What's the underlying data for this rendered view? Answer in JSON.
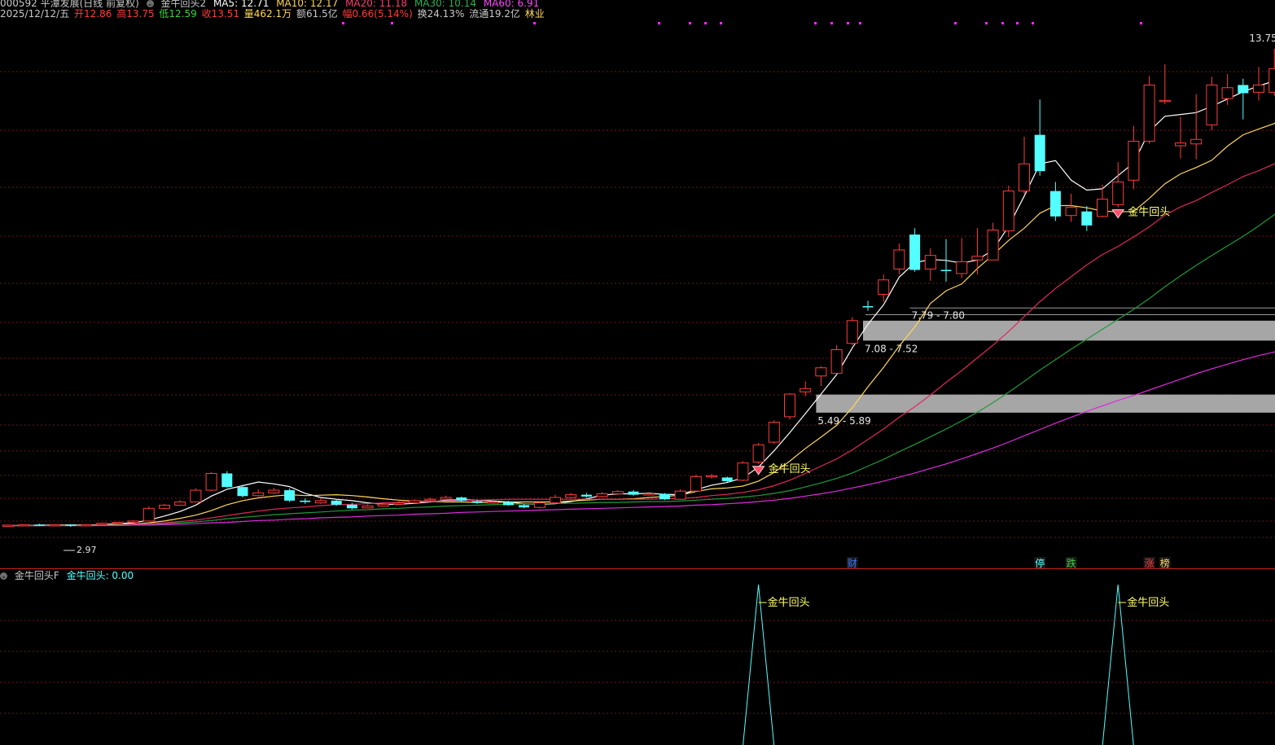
{
  "header": {
    "stock": "000592 平潭发展(日线 前复权)",
    "indicator": "金牛回头2",
    "ma5": "MA5: 12.71",
    "ma10": "MA10: 12.17",
    "ma20": "MA20: 11.18",
    "ma30": "MA30: 10.14",
    "ma60": "MA60: 6.91",
    "date": "2025/12/12/五",
    "open": "开12.86",
    "high": "高13.75",
    "low": "低12.59",
    "close": "收13.51",
    "volume": "量462.1万",
    "amount": "额61.5亿",
    "change": "幅0.66(5.14%)",
    "turnover": "换24.13%",
    "float_cap": "流通19.2亿",
    "sector": "林业"
  },
  "colors": {
    "up": "#ff3c3c",
    "down": "#54ffff",
    "ma5": "#ffffff",
    "ma10": "#ffd75a",
    "ma20": "#e0285a",
    "ma30": "#1f9a3a",
    "ma60": "#e02ae0",
    "grid": "#6e1616"
  },
  "main_chart": {
    "price_range": [
      2.2,
      14.2
    ],
    "max_label": "13.75",
    "min_label": "2.97",
    "zones": [
      {
        "label": "7.79 - 7.80",
        "low": 7.79,
        "high": 7.8,
        "start": 58
      },
      {
        "label": "7.08 - 7.52",
        "low": 7.08,
        "high": 7.52,
        "start": 55
      },
      {
        "label": "5.49 - 5.89",
        "low": 5.49,
        "high": 5.89,
        "start": 52
      }
    ],
    "signals": [
      {
        "index": 48,
        "label": "金牛回头"
      },
      {
        "index": 71,
        "label": "金牛回头"
      }
    ],
    "event_markers": [
      {
        "index": 54,
        "text": "财"
      },
      {
        "index": 66,
        "text": "停"
      },
      {
        "index": 68,
        "text": "跌"
      },
      {
        "index": 73,
        "text": "涨"
      },
      {
        "index": 74,
        "text": "榜"
      }
    ],
    "candles": [
      [
        3.0,
        3.01,
        2.98,
        3.02
      ],
      [
        3.01,
        3.02,
        3.0,
        3.03
      ],
      [
        3.02,
        3.01,
        2.99,
        3.04
      ],
      [
        3.01,
        3.02,
        3.0,
        3.03
      ],
      [
        3.02,
        3.0,
        2.97,
        3.03
      ],
      [
        3.0,
        3.02,
        2.99,
        3.03
      ],
      [
        3.02,
        3.05,
        3.01,
        3.06
      ],
      [
        3.05,
        3.07,
        3.04,
        3.08
      ],
      [
        3.07,
        3.1,
        3.06,
        3.12
      ],
      [
        3.1,
        3.38,
        3.09,
        3.42
      ],
      [
        3.38,
        3.45,
        3.36,
        3.48
      ],
      [
        3.45,
        3.52,
        3.44,
        3.56
      ],
      [
        3.52,
        3.78,
        3.51,
        3.82
      ],
      [
        3.78,
        4.15,
        3.76,
        4.18
      ],
      [
        4.15,
        3.85,
        3.83,
        4.2
      ],
      [
        3.85,
        3.65,
        3.62,
        3.9
      ],
      [
        3.66,
        3.72,
        3.64,
        3.8
      ],
      [
        3.72,
        3.78,
        3.7,
        3.83
      ],
      [
        3.78,
        3.55,
        3.52,
        3.82
      ],
      [
        3.55,
        3.52,
        3.48,
        3.6
      ],
      [
        3.5,
        3.55,
        3.48,
        3.6
      ],
      [
        3.55,
        3.46,
        3.44,
        3.58
      ],
      [
        3.46,
        3.38,
        3.36,
        3.5
      ],
      [
        3.39,
        3.43,
        3.38,
        3.46
      ],
      [
        3.43,
        3.47,
        3.42,
        3.5
      ],
      [
        3.47,
        3.5,
        3.45,
        3.54
      ],
      [
        3.5,
        3.55,
        3.48,
        3.58
      ],
      [
        3.55,
        3.58,
        3.53,
        3.62
      ],
      [
        3.58,
        3.62,
        3.56,
        3.66
      ],
      [
        3.62,
        3.55,
        3.53,
        3.64
      ],
      [
        3.54,
        3.5,
        3.48,
        3.57
      ],
      [
        3.51,
        3.52,
        3.48,
        3.56
      ],
      [
        3.52,
        3.45,
        3.44,
        3.55
      ],
      [
        3.45,
        3.4,
        3.38,
        3.48
      ],
      [
        3.4,
        3.5,
        3.38,
        3.52
      ],
      [
        3.5,
        3.62,
        3.49,
        3.68
      ],
      [
        3.62,
        3.68,
        3.6,
        3.72
      ],
      [
        3.68,
        3.64,
        3.62,
        3.72
      ],
      [
        3.64,
        3.7,
        3.62,
        3.74
      ],
      [
        3.7,
        3.75,
        3.68,
        3.78
      ],
      [
        3.75,
        3.68,
        3.66,
        3.78
      ],
      [
        3.68,
        3.7,
        3.66,
        3.74
      ],
      [
        3.7,
        3.58,
        3.56,
        3.72
      ],
      [
        3.58,
        3.76,
        3.57,
        3.8
      ],
      [
        3.76,
        4.08,
        3.75,
        4.12
      ],
      [
        4.08,
        4.1,
        4.04,
        4.14
      ],
      [
        4.06,
        3.98,
        3.96,
        4.08
      ],
      [
        4.0,
        4.38,
        3.98,
        4.42
      ],
      [
        4.4,
        4.78,
        4.36,
        4.82
      ],
      [
        4.84,
        5.28,
        4.8,
        5.32
      ],
      [
        5.4,
        5.9,
        5.34,
        5.92
      ],
      [
        5.95,
        6.02,
        5.85,
        6.18
      ],
      [
        6.3,
        6.48,
        6.08,
        6.52
      ],
      [
        6.36,
        6.88,
        6.34,
        6.98
      ],
      [
        7.02,
        7.52,
        6.98,
        7.6
      ],
      [
        7.84,
        7.82,
        7.74,
        7.96
      ],
      [
        8.1,
        8.42,
        7.94,
        8.54
      ],
      [
        8.66,
        9.08,
        8.54,
        9.22
      ],
      [
        9.42,
        8.64,
        8.6,
        9.56
      ],
      [
        8.66,
        8.96,
        8.4,
        9.12
      ],
      [
        8.64,
        8.62,
        8.38,
        9.32
      ],
      [
        8.56,
        8.82,
        8.46,
        9.34
      ],
      [
        8.86,
        8.94,
        8.54,
        9.56
      ],
      [
        8.86,
        9.52,
        8.86,
        9.68
      ],
      [
        9.5,
        10.38,
        9.36,
        10.5
      ],
      [
        10.38,
        10.98,
        10.32,
        11.58
      ],
      [
        11.62,
        10.82,
        10.72,
        12.4
      ],
      [
        10.38,
        9.82,
        9.72,
        10.58
      ],
      [
        9.84,
        10.02,
        9.7,
        10.32
      ],
      [
        9.93,
        9.62,
        9.5,
        10.05
      ],
      [
        9.82,
        10.2,
        9.8,
        10.52
      ],
      [
        10.08,
        10.58,
        10.02,
        11.02
      ],
      [
        10.62,
        11.48,
        10.42,
        11.82
      ],
      [
        11.48,
        12.72,
        11.42,
        12.92
      ],
      [
        12.36,
        12.38,
        12.3,
        13.18
      ],
      [
        11.38,
        11.44,
        11.1,
        12.02
      ],
      [
        11.42,
        11.52,
        11.08,
        12.52
      ],
      [
        11.84,
        12.72,
        11.72,
        12.9
      ],
      [
        12.42,
        12.66,
        12.28,
        12.96
      ],
      [
        12.72,
        12.54,
        11.96,
        12.86
      ],
      [
        12.56,
        12.72,
        12.38,
        13.12
      ],
      [
        12.56,
        13.08,
        12.48,
        13.52
      ],
      [
        12.86,
        13.51,
        12.59,
        13.75
      ]
    ],
    "ma_lines": {
      "ma5": [
        3.0,
        3.0,
        3.01,
        3.01,
        3.01,
        3.01,
        3.02,
        3.04,
        3.06,
        3.12,
        3.21,
        3.31,
        3.45,
        3.65,
        3.8,
        3.88,
        3.96,
        3.92,
        3.86,
        3.71,
        3.62,
        3.58,
        3.55,
        3.5,
        3.47,
        3.47,
        3.49,
        3.52,
        3.56,
        3.57,
        3.56,
        3.54,
        3.52,
        3.48,
        3.47,
        3.48,
        3.53,
        3.59,
        3.67,
        3.7,
        3.7,
        3.71,
        3.69,
        3.68,
        3.79,
        3.89,
        3.95,
        4.05,
        4.29,
        4.65,
        5.05,
        5.47,
        5.9,
        6.33,
        6.92,
        7.44,
        7.87,
        8.48,
        8.8,
        8.87,
        8.85,
        8.79,
        8.86,
        9.08,
        9.6,
        10.27,
        10.98,
        11.05,
        10.62,
        10.4,
        10.43,
        10.72,
        11.0,
        11.7,
        12.03,
        12.07,
        12.11,
        12.25,
        12.41,
        12.57,
        12.7,
        12.81,
        12.71
      ],
      "ma10": [
        3.0,
        3.0,
        3.0,
        3.01,
        3.01,
        3.01,
        3.01,
        3.02,
        3.03,
        3.06,
        3.1,
        3.16,
        3.23,
        3.33,
        3.46,
        3.55,
        3.61,
        3.65,
        3.68,
        3.66,
        3.67,
        3.68,
        3.66,
        3.63,
        3.59,
        3.56,
        3.54,
        3.53,
        3.52,
        3.52,
        3.51,
        3.51,
        3.52,
        3.52,
        3.52,
        3.52,
        3.54,
        3.56,
        3.58,
        3.58,
        3.59,
        3.62,
        3.64,
        3.67,
        3.75,
        3.81,
        3.83,
        3.87,
        3.98,
        4.17,
        4.42,
        4.7,
        4.95,
        5.21,
        5.6,
        6.06,
        6.49,
        6.96,
        7.38,
        7.9,
        8.18,
        8.33,
        8.67,
        8.97,
        9.29,
        9.56,
        9.89,
        10.06,
        10.06,
        10.01,
        9.94,
        9.92,
        9.93,
        10.22,
        10.54,
        10.76,
        10.9,
        11.06,
        11.37,
        11.62,
        11.75,
        11.87,
        12.17
      ],
      "ma20": [
        3.0,
        3.0,
        3.0,
        3.0,
        3.0,
        3.0,
        3.01,
        3.01,
        3.02,
        3.04,
        3.06,
        3.09,
        3.12,
        3.17,
        3.22,
        3.27,
        3.32,
        3.36,
        3.39,
        3.41,
        3.44,
        3.46,
        3.47,
        3.48,
        3.5,
        3.51,
        3.52,
        3.53,
        3.54,
        3.55,
        3.56,
        3.57,
        3.58,
        3.58,
        3.58,
        3.58,
        3.58,
        3.58,
        3.58,
        3.58,
        3.58,
        3.58,
        3.59,
        3.6,
        3.62,
        3.66,
        3.69,
        3.73,
        3.79,
        3.88,
        4.0,
        4.15,
        4.31,
        4.47,
        4.67,
        4.9,
        5.13,
        5.39,
        5.62,
        5.88,
        6.16,
        6.42,
        6.7,
        6.98,
        7.28,
        7.61,
        7.94,
        8.23,
        8.49,
        8.75,
        8.98,
        9.16,
        9.37,
        9.59,
        9.85,
        10.03,
        10.17,
        10.35,
        10.52,
        10.7,
        10.83,
        10.98,
        11.18
      ],
      "ma30": [
        3.0,
        3.0,
        3.0,
        3.0,
        3.0,
        3.0,
        3.0,
        3.01,
        3.01,
        3.02,
        3.04,
        3.06,
        3.08,
        3.11,
        3.15,
        3.18,
        3.21,
        3.24,
        3.26,
        3.28,
        3.3,
        3.32,
        3.34,
        3.35,
        3.37,
        3.38,
        3.4,
        3.41,
        3.43,
        3.44,
        3.45,
        3.46,
        3.47,
        3.48,
        3.48,
        3.49,
        3.49,
        3.5,
        3.51,
        3.51,
        3.52,
        3.53,
        3.53,
        3.54,
        3.56,
        3.58,
        3.6,
        3.63,
        3.66,
        3.71,
        3.77,
        3.85,
        3.94,
        4.04,
        4.16,
        4.31,
        4.46,
        4.63,
        4.79,
        4.96,
        5.13,
        5.31,
        5.5,
        5.71,
        5.94,
        6.18,
        6.43,
        6.66,
        6.89,
        7.11,
        7.33,
        7.55,
        7.77,
        8.01,
        8.27,
        8.51,
        8.74,
        8.96,
        9.17,
        9.38,
        9.61,
        9.86,
        10.14
      ],
      "ma60": [
        3.0,
        3.0,
        3.0,
        3.0,
        3.0,
        3.0,
        3.0,
        3.0,
        3.01,
        3.01,
        3.02,
        3.03,
        3.04,
        3.06,
        3.07,
        3.09,
        3.11,
        3.12,
        3.14,
        3.15,
        3.17,
        3.18,
        3.19,
        3.21,
        3.22,
        3.23,
        3.25,
        3.26,
        3.27,
        3.29,
        3.3,
        3.31,
        3.32,
        3.33,
        3.34,
        3.35,
        3.36,
        3.37,
        3.38,
        3.39,
        3.4,
        3.41,
        3.42,
        3.43,
        3.45,
        3.46,
        3.48,
        3.5,
        3.53,
        3.56,
        3.6,
        3.65,
        3.7,
        3.76,
        3.83,
        3.9,
        3.98,
        4.07,
        4.16,
        4.26,
        4.36,
        4.47,
        4.59,
        4.71,
        4.84,
        4.98,
        5.12,
        5.26,
        5.39,
        5.52,
        5.64,
        5.76,
        5.87,
        5.99,
        6.11,
        6.23,
        6.35,
        6.46,
        6.56,
        6.66,
        6.75,
        6.83,
        6.91
      ]
    }
  },
  "sub_chart": {
    "title": "金牛回头F",
    "value_label": "金牛回头: 0.00",
    "signal_label": "金牛回头"
  }
}
